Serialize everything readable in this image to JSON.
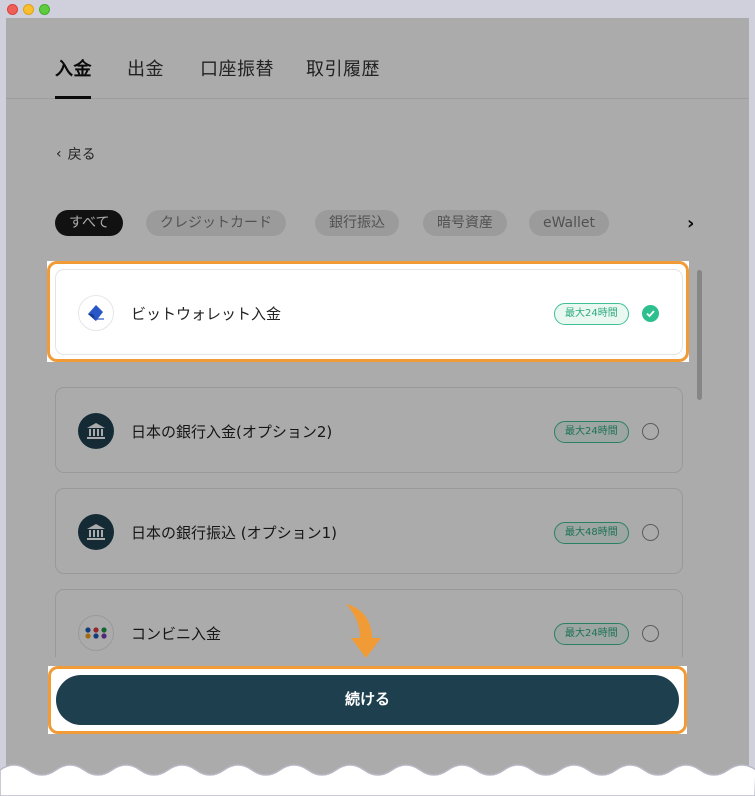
{
  "tabs": [
    {
      "label": "入金",
      "active": true
    },
    {
      "label": "出金",
      "active": false
    },
    {
      "label": "口座振替",
      "active": false
    },
    {
      "label": "取引履歴",
      "active": false
    }
  ],
  "back_label": "戻る",
  "filters": [
    {
      "label": "すべて",
      "active": true
    },
    {
      "label": "クレジットカード",
      "active": false
    },
    {
      "label": "銀行振込",
      "active": false
    },
    {
      "label": "暗号資産",
      "active": false
    },
    {
      "label": "eWallet",
      "active": false
    }
  ],
  "methods": [
    {
      "name": "ビットウォレット入金",
      "badge": "最大24時間",
      "selected": true,
      "icon": "bitwallet-logo-icon"
    },
    {
      "name": "日本の銀行入金(オプション2)",
      "badge": "最大24時間",
      "selected": false,
      "icon": "bank-icon"
    },
    {
      "name": "日本の銀行振込 (オプション1)",
      "badge": "最大48時間",
      "selected": false,
      "icon": "bank-icon"
    },
    {
      "name": "コンビニ入金",
      "badge": "最大24時間",
      "selected": false,
      "icon": "convenience-store-icon"
    }
  ],
  "continue_label": "続ける",
  "colors": {
    "accent_highlight": "#f19b36",
    "primary_button": "#1e3f4e",
    "badge_green": "#2fa981",
    "selected_radio": "#2ebf8f"
  }
}
